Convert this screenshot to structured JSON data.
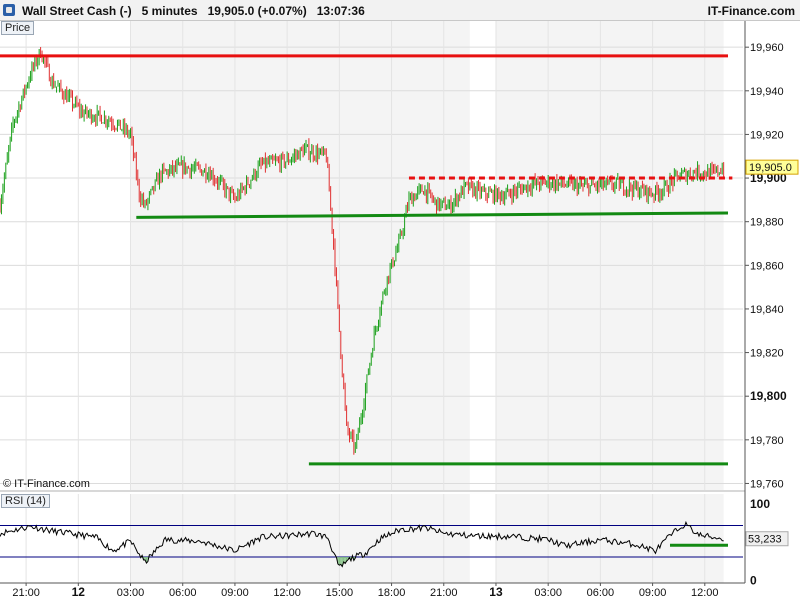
{
  "header": {
    "instrument": "Wall Street Cash (-)",
    "timeframe": "5 minutes",
    "last": "19,905.0 (+0.07%)",
    "time": "13:07:36",
    "brand": "IT-Finance.com"
  },
  "price_badge": "Price",
  "rsi_badge": "RSI (14)",
  "copyright": "© IT-Finance.com",
  "colors": {
    "up": "#1aa01a",
    "down": "#e03030",
    "resistance": "#e81010",
    "support": "#138a13",
    "rsi_line": "#000000",
    "rsi_band": "#000080",
    "current_tag": "#ffff99"
  },
  "chart_data": [
    {
      "type": "candlestick",
      "title": "Wall Street Cash (-) 5 minutes",
      "ylabel": "Price",
      "ylim": [
        19757,
        19972
      ],
      "y_ticks": [
        "19,960",
        "19,940",
        "19,920",
        "19,900",
        "19,880",
        "19,860",
        "19,840",
        "19,820",
        "19,800",
        "19,780",
        "19,760"
      ],
      "y_tick_values": [
        19960,
        19940,
        19920,
        19900,
        19880,
        19860,
        19840,
        19820,
        19800,
        19780,
        19760
      ],
      "x_ticks": [
        "21:00",
        "12",
        "03:00",
        "06:00",
        "09:00",
        "12:00",
        "15:00",
        "18:00",
        "21:00",
        "13",
        "03:00",
        "06:00",
        "09:00",
        "12:00"
      ],
      "current_value": "19,905.0",
      "grid": true,
      "shaded_sessions": [
        {
          "from": "12 03:00",
          "to": "12 22:30"
        },
        {
          "from": "13 00:00",
          "to": "13 13:05"
        }
      ],
      "candle_anchors": [
        {
          "x": "11 19:30",
          "close": 19888
        },
        {
          "x": "11 20:15",
          "close": 19925
        },
        {
          "x": "11 21:15",
          "close": 19948
        },
        {
          "x": "11 21:50",
          "close": 19958
        },
        {
          "x": "11 22:30",
          "close": 19944
        },
        {
          "x": "12 00:15",
          "close": 19930
        },
        {
          "x": "12 01:45",
          "close": 19927
        },
        {
          "x": "12 03:00",
          "close": 19920
        },
        {
          "x": "12 03:30",
          "close": 19893
        },
        {
          "x": "12 03:50",
          "close": 19887
        },
        {
          "x": "12 04:45",
          "close": 19902
        },
        {
          "x": "12 06:00",
          "close": 19905
        },
        {
          "x": "12 07:30",
          "close": 19903
        },
        {
          "x": "12 09:00",
          "close": 19890
        },
        {
          "x": "12 10:30",
          "close": 19906
        },
        {
          "x": "12 12:00",
          "close": 19908
        },
        {
          "x": "12 13:00",
          "close": 19913
        },
        {
          "x": "12 14:15",
          "close": 19910
        },
        {
          "x": "12 14:40",
          "close": 19870
        },
        {
          "x": "12 15:00",
          "close": 19830
        },
        {
          "x": "12 15:25",
          "close": 19785
        },
        {
          "x": "12 15:55",
          "close": 19776
        },
        {
          "x": "12 16:20",
          "close": 19795
        },
        {
          "x": "12 17:00",
          "close": 19828
        },
        {
          "x": "12 17:40",
          "close": 19852
        },
        {
          "x": "12 18:30",
          "close": 19872
        },
        {
          "x": "12 19:00",
          "close": 19890
        },
        {
          "x": "12 19:50",
          "close": 19895
        },
        {
          "x": "12 20:35",
          "close": 19888
        },
        {
          "x": "12 21:20",
          "close": 19887
        },
        {
          "x": "12 22:15",
          "close": 19896
        },
        {
          "x": "12 23:15",
          "close": 19893
        },
        {
          "x": "13 00:30",
          "close": 19892
        },
        {
          "x": "13 02:00",
          "close": 19897
        },
        {
          "x": "13 03:00",
          "close": 19898
        },
        {
          "x": "13 05:00",
          "close": 19896
        },
        {
          "x": "13 07:00",
          "close": 19897
        },
        {
          "x": "13 09:00",
          "close": 19893
        },
        {
          "x": "13 09:40",
          "close": 19895
        },
        {
          "x": "13 10:30",
          "close": 19901
        },
        {
          "x": "13 11:30",
          "close": 19903
        },
        {
          "x": "13 12:30",
          "close": 19902
        },
        {
          "x": "13 13:05",
          "close": 19905
        }
      ],
      "annotations": [
        {
          "kind": "resistance",
          "style": "solid",
          "from": "11 19:30",
          "to": "13 13:20",
          "y": 19956
        },
        {
          "kind": "support",
          "style": "solid",
          "from": "12 03:20",
          "to": "13 13:20",
          "y_start": 19882,
          "y_end": 19884
        },
        {
          "kind": "resistance",
          "style": "dashed",
          "from": "12 19:00",
          "to": "13 13:35",
          "y": 19900
        },
        {
          "kind": "support",
          "style": "solid",
          "from": "12 13:15",
          "to": "13 13:20",
          "y": 19769
        }
      ]
    },
    {
      "type": "line",
      "title": "RSI (14)",
      "ylim": [
        -3,
        110
      ],
      "y_ticks": [
        "100",
        "0"
      ],
      "y_tick_values": [
        100,
        0
      ],
      "bands": [
        70,
        30
      ],
      "current_value": "53,233",
      "x_ticks": [
        "21:00",
        "12",
        "03:00",
        "06:00",
        "09:00",
        "12:00",
        "15:00",
        "18:00",
        "21:00",
        "13",
        "03:00",
        "06:00",
        "09:00",
        "12:00"
      ],
      "rsi_anchors": [
        {
          "x": "11 19:30",
          "y": 60
        },
        {
          "x": "11 21:15",
          "y": 69
        },
        {
          "x": "11 22:30",
          "y": 63
        },
        {
          "x": "12 01:00",
          "y": 55
        },
        {
          "x": "12 02:00",
          "y": 38
        },
        {
          "x": "12 03:00",
          "y": 50
        },
        {
          "x": "12 03:50",
          "y": 23
        },
        {
          "x": "12 05:00",
          "y": 52
        },
        {
          "x": "12 07:00",
          "y": 50
        },
        {
          "x": "12 09:00",
          "y": 38
        },
        {
          "x": "12 10:30",
          "y": 55
        },
        {
          "x": "12 12:00",
          "y": 57
        },
        {
          "x": "12 13:30",
          "y": 60
        },
        {
          "x": "12 14:20",
          "y": 55
        },
        {
          "x": "12 15:00",
          "y": 16
        },
        {
          "x": "12 15:40",
          "y": 28
        },
        {
          "x": "12 16:30",
          "y": 35
        },
        {
          "x": "12 17:20",
          "y": 53
        },
        {
          "x": "12 18:30",
          "y": 65
        },
        {
          "x": "12 20:00",
          "y": 67
        },
        {
          "x": "12 21:00",
          "y": 60
        },
        {
          "x": "12 22:30",
          "y": 57
        },
        {
          "x": "13 01:00",
          "y": 56
        },
        {
          "x": "13 03:00",
          "y": 52
        },
        {
          "x": "13 04:00",
          "y": 44
        },
        {
          "x": "13 06:00",
          "y": 52
        },
        {
          "x": "13 08:00",
          "y": 46
        },
        {
          "x": "13 09:10",
          "y": 38
        },
        {
          "x": "13 10:00",
          "y": 57
        },
        {
          "x": "13 10:50",
          "y": 72
        },
        {
          "x": "13 11:40",
          "y": 58
        },
        {
          "x": "13 12:30",
          "y": 55
        },
        {
          "x": "13 13:05",
          "y": 53
        }
      ],
      "annotations": [
        {
          "kind": "support",
          "style": "solid",
          "from": "13 10:00",
          "to": "13 13:20",
          "y": 45
        }
      ]
    }
  ]
}
